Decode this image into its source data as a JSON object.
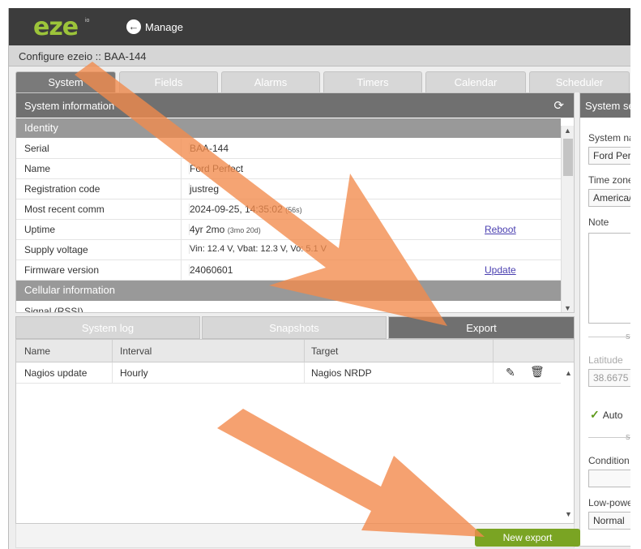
{
  "app": {
    "logo": "eze",
    "logo_sup": "io",
    "manage_label": "Manage",
    "breadcrumb": "Configure ezeio :: BAA-144"
  },
  "tabs": [
    {
      "label": "System",
      "active": true
    },
    {
      "label": "Fields",
      "active": false
    },
    {
      "label": "Alarms",
      "active": false
    },
    {
      "label": "Timers",
      "active": false
    },
    {
      "label": "Calendar",
      "active": false
    },
    {
      "label": "Scheduler",
      "active": false
    }
  ],
  "system_info": {
    "title": "System information",
    "identity_header": "Identity",
    "rows": [
      {
        "key": "Serial",
        "value": "BAA-144"
      },
      {
        "key": "Name",
        "value": "Ford Perfect"
      },
      {
        "key": "Registration code",
        "value": "justreg"
      },
      {
        "key": "Most recent comm",
        "value": "2024-09-25, 14:35:02",
        "note": "(56s)"
      },
      {
        "key": "Uptime",
        "value": "4yr 2mo",
        "note": "(3mo 20d)",
        "link": "Reboot"
      },
      {
        "key": "Supply voltage",
        "value": "Vin: 12.4 V, Vbat: 12.3 V, Vo: 5.1 V"
      },
      {
        "key": "Firmware version",
        "value": "24060601",
        "link": "Update"
      }
    ],
    "cellular_header": "Cellular information",
    "cut_row": {
      "key": "Signal (RSSI)"
    }
  },
  "settings": {
    "title": "System settings",
    "system_name_label": "System name",
    "system_name_value": "Ford Perfect",
    "timezone_label": "Time zone",
    "timezone_value": "America/",
    "note_label": "Note",
    "divider1": "SYS",
    "latitude_label": "Latitude",
    "latitude_value": "38.6675",
    "auto_label": "Auto",
    "divider2": "SYS",
    "condition_label": "Condition",
    "lowpower_label": "Low-power",
    "lowpower_value": "Normal"
  },
  "subtabs": [
    {
      "label": "System log",
      "active": false
    },
    {
      "label": "Snapshots",
      "active": false
    },
    {
      "label": "Export",
      "active": true
    }
  ],
  "export_table": {
    "columns": [
      "Name",
      "Interval",
      "Target"
    ],
    "rows": [
      {
        "name": "Nagios update",
        "interval": "Hourly",
        "target": "Nagios NRDP"
      }
    ]
  },
  "footer": {
    "new_export_label": "New export"
  },
  "colors": {
    "brand_green": "#9cc43a",
    "button_green": "#7aa423",
    "annotation_orange": "#f28a4c",
    "header_dark": "#3c3c3c",
    "panel_header": "#707070"
  }
}
